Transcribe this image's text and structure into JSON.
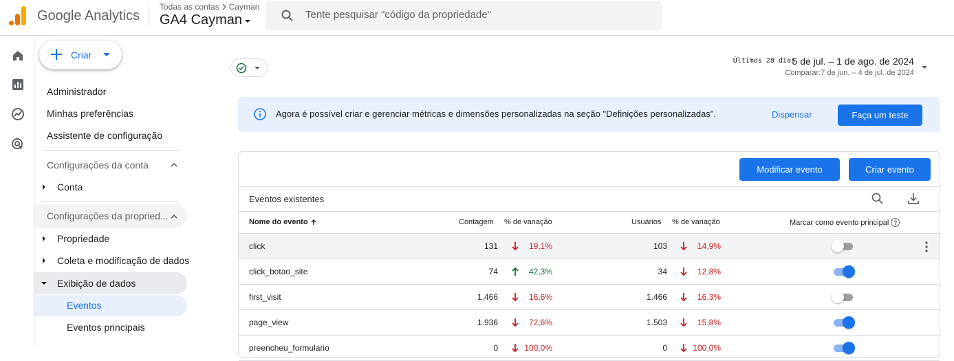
{
  "header": {
    "product_name": "Google Analytics",
    "breadcrumb_parent": "Todas as contas",
    "breadcrumb_child": "Cayman",
    "property_name": "GA4 Cayman",
    "search_placeholder": "Tente pesquisar \"código da propriedade\""
  },
  "rail": {
    "icons": [
      "home-icon",
      "reports-icon",
      "explore-icon",
      "advertising-icon"
    ]
  },
  "nav": {
    "create_label": "Criar",
    "admin": "Administrador",
    "preferences": "Minhas preferências",
    "setup_assistant": "Assistente de configuração",
    "account_settings": "Configurações da conta",
    "account": "Conta",
    "property_settings": "Configurações da propried...",
    "property": "Propriedade",
    "data_collection": "Coleta e modificação de dados",
    "data_display": "Exibição de dados",
    "events": "Eventos",
    "key_events": "Eventos principais"
  },
  "date": {
    "preset": "Últimos 28 dias",
    "range": "5 de jul. – 1 de ago. de 2024",
    "compare": "Comparar:7 de jun. – 4 de jul. de 2024"
  },
  "banner": {
    "text": "Agora é possível criar e gerenciar métricas e dimensões personalizadas na seção \"Definições personalizadas\".",
    "dismiss": "Dispensar",
    "try": "Faça um teste"
  },
  "card": {
    "modify_button": "Modificar evento",
    "create_button": "Criar evento",
    "title": "Eventos existentes",
    "columns": {
      "name": "Nome do evento",
      "count": "Contagem",
      "var1": "% de variação",
      "users": "Usuários",
      "var2": "% de variação",
      "key": "Marcar como evento principal"
    },
    "rows": [
      {
        "name": "click",
        "count": "131",
        "var1": "19,1%",
        "dir1": "down",
        "users": "103",
        "var2": "14,9%",
        "dir2": "down",
        "key": false
      },
      {
        "name": "click_botao_site",
        "count": "74",
        "var1": "42,3%",
        "dir1": "up",
        "users": "34",
        "var2": "12,8%",
        "dir2": "down",
        "key": true
      },
      {
        "name": "first_visit",
        "count": "1.466",
        "var1": "16,6%",
        "dir1": "down",
        "users": "1.466",
        "var2": "16,3%",
        "dir2": "down",
        "key": false
      },
      {
        "name": "page_view",
        "count": "1.936",
        "var1": "72,6%",
        "dir1": "down",
        "users": "1.503",
        "var2": "15,8%",
        "dir2": "down",
        "key": true
      },
      {
        "name": "preencheu_formulario",
        "count": "0",
        "var1": "100,0%",
        "dir1": "down",
        "users": "0",
        "var2": "100,0%",
        "dir2": "down",
        "key": true
      }
    ]
  },
  "colors": {
    "accent": "#1a73e8",
    "negative": "#c5221f",
    "positive": "#137333"
  }
}
